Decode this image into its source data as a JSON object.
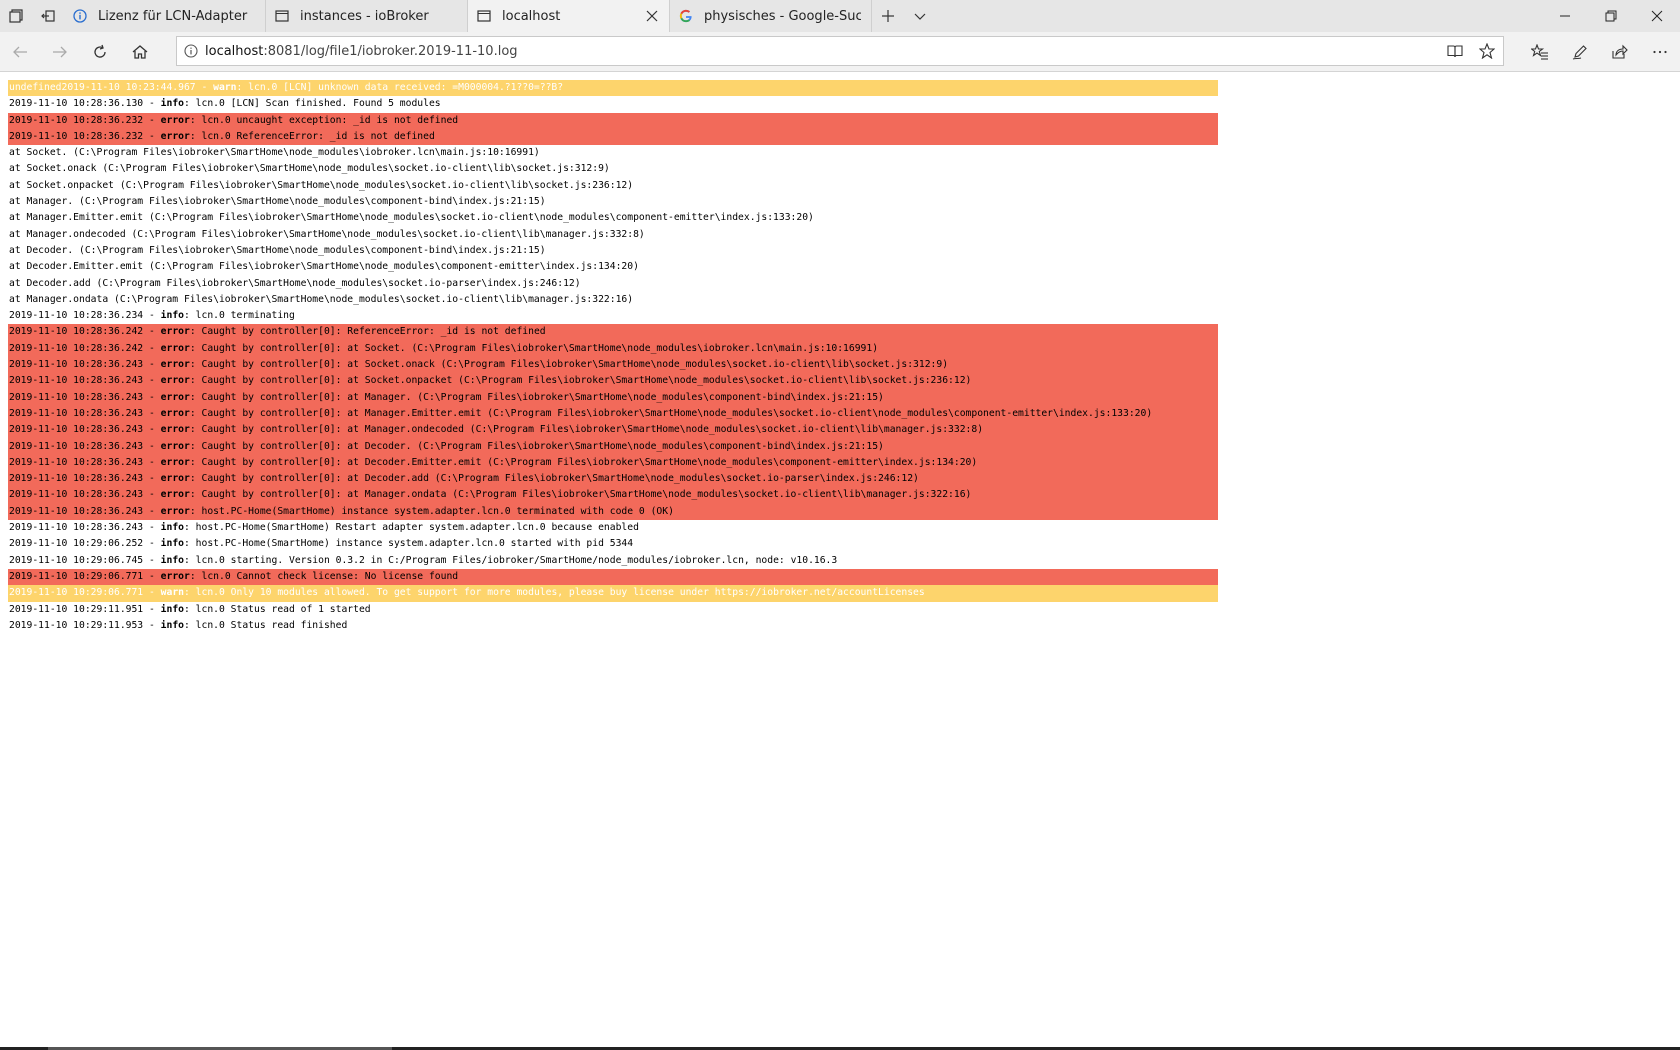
{
  "tabs": [
    {
      "title": "Lizenz für LCN-Adapter",
      "icon": "info-circle-icon",
      "active": false
    },
    {
      "title": "instances - ioBroker",
      "icon": "page-icon",
      "active": false
    },
    {
      "title": "localhost",
      "icon": "page-icon",
      "active": true
    },
    {
      "title": "physisches - Google-Suche",
      "icon": "google-icon",
      "active": false
    }
  ],
  "address": {
    "host": "localhost",
    "path": ":8081/log/file1/iobroker.2019-11-10.log"
  },
  "colors": {
    "error_bg": "#f26a5a",
    "warn_bg": "#fdd46c"
  },
  "log_lines": [
    {
      "type": "warn",
      "prefix": "undefined2019-11-10 10:23:44.967 - ",
      "level": "warn",
      "message": ": lcn.0 [LCN] unknown data received: =M000004.?1??0=??B?"
    },
    {
      "type": "info",
      "prefix": "2019-11-10 10:28:36.130 - ",
      "level": "info",
      "message": ": lcn.0 [LCN] Scan finished. Found 5 modules"
    },
    {
      "type": "error",
      "prefix": "2019-11-10 10:28:36.232 - ",
      "level": "error",
      "message": ": lcn.0 uncaught exception: _id is not defined"
    },
    {
      "type": "error",
      "prefix": "2019-11-10 10:28:36.232 - ",
      "level": "error",
      "message": ": lcn.0 ReferenceError: _id is not defined"
    },
    {
      "type": "plain",
      "prefix": "",
      "level": "",
      "message": "at Socket. (C:\\Program Files\\iobroker\\SmartHome\\node_modules\\iobroker.lcn\\main.js:10:16991)"
    },
    {
      "type": "plain",
      "prefix": "",
      "level": "",
      "message": "at Socket.onack (C:\\Program Files\\iobroker\\SmartHome\\node_modules\\socket.io-client\\lib\\socket.js:312:9)"
    },
    {
      "type": "plain",
      "prefix": "",
      "level": "",
      "message": "at Socket.onpacket (C:\\Program Files\\iobroker\\SmartHome\\node_modules\\socket.io-client\\lib\\socket.js:236:12)"
    },
    {
      "type": "plain",
      "prefix": "",
      "level": "",
      "message": "at Manager. (C:\\Program Files\\iobroker\\SmartHome\\node_modules\\component-bind\\index.js:21:15)"
    },
    {
      "type": "plain",
      "prefix": "",
      "level": "",
      "message": "at Manager.Emitter.emit (C:\\Program Files\\iobroker\\SmartHome\\node_modules\\socket.io-client\\node_modules\\component-emitter\\index.js:133:20)"
    },
    {
      "type": "plain",
      "prefix": "",
      "level": "",
      "message": "at Manager.ondecoded (C:\\Program Files\\iobroker\\SmartHome\\node_modules\\socket.io-client\\lib\\manager.js:332:8)"
    },
    {
      "type": "plain",
      "prefix": "",
      "level": "",
      "message": "at Decoder. (C:\\Program Files\\iobroker\\SmartHome\\node_modules\\component-bind\\index.js:21:15)"
    },
    {
      "type": "plain",
      "prefix": "",
      "level": "",
      "message": "at Decoder.Emitter.emit (C:\\Program Files\\iobroker\\SmartHome\\node_modules\\component-emitter\\index.js:134:20)"
    },
    {
      "type": "plain",
      "prefix": "",
      "level": "",
      "message": "at Decoder.add (C:\\Program Files\\iobroker\\SmartHome\\node_modules\\socket.io-parser\\index.js:246:12)"
    },
    {
      "type": "plain",
      "prefix": "",
      "level": "",
      "message": "at Manager.ondata (C:\\Program Files\\iobroker\\SmartHome\\node_modules\\socket.io-client\\lib\\manager.js:322:16)"
    },
    {
      "type": "info",
      "prefix": "2019-11-10 10:28:36.234 - ",
      "level": "info",
      "message": ": lcn.0 terminating"
    },
    {
      "type": "error",
      "prefix": "2019-11-10 10:28:36.242 - ",
      "level": "error",
      "message": ": Caught by controller[0]: ReferenceError: _id is not defined"
    },
    {
      "type": "error",
      "prefix": "2019-11-10 10:28:36.242 - ",
      "level": "error",
      "message": ": Caught by controller[0]: at Socket. (C:\\Program Files\\iobroker\\SmartHome\\node_modules\\iobroker.lcn\\main.js:10:16991)"
    },
    {
      "type": "error",
      "prefix": "2019-11-10 10:28:36.243 - ",
      "level": "error",
      "message": ": Caught by controller[0]: at Socket.onack (C:\\Program Files\\iobroker\\SmartHome\\node_modules\\socket.io-client\\lib\\socket.js:312:9)"
    },
    {
      "type": "error",
      "prefix": "2019-11-10 10:28:36.243 - ",
      "level": "error",
      "message": ": Caught by controller[0]: at Socket.onpacket (C:\\Program Files\\iobroker\\SmartHome\\node_modules\\socket.io-client\\lib\\socket.js:236:12)"
    },
    {
      "type": "error",
      "prefix": "2019-11-10 10:28:36.243 - ",
      "level": "error",
      "message": ": Caught by controller[0]: at Manager. (C:\\Program Files\\iobroker\\SmartHome\\node_modules\\component-bind\\index.js:21:15)"
    },
    {
      "type": "error",
      "prefix": "2019-11-10 10:28:36.243 - ",
      "level": "error",
      "message": ": Caught by controller[0]: at Manager.Emitter.emit (C:\\Program Files\\iobroker\\SmartHome\\node_modules\\socket.io-client\\node_modules\\component-emitter\\index.js:133:20)"
    },
    {
      "type": "error",
      "prefix": "2019-11-10 10:28:36.243 - ",
      "level": "error",
      "message": ": Caught by controller[0]: at Manager.ondecoded (C:\\Program Files\\iobroker\\SmartHome\\node_modules\\socket.io-client\\lib\\manager.js:332:8)"
    },
    {
      "type": "error",
      "prefix": "2019-11-10 10:28:36.243 - ",
      "level": "error",
      "message": ": Caught by controller[0]: at Decoder. (C:\\Program Files\\iobroker\\SmartHome\\node_modules\\component-bind\\index.js:21:15)"
    },
    {
      "type": "error",
      "prefix": "2019-11-10 10:28:36.243 - ",
      "level": "error",
      "message": ": Caught by controller[0]: at Decoder.Emitter.emit (C:\\Program Files\\iobroker\\SmartHome\\node_modules\\component-emitter\\index.js:134:20)"
    },
    {
      "type": "error",
      "prefix": "2019-11-10 10:28:36.243 - ",
      "level": "error",
      "message": ": Caught by controller[0]: at Decoder.add (C:\\Program Files\\iobroker\\SmartHome\\node_modules\\socket.io-parser\\index.js:246:12)"
    },
    {
      "type": "error",
      "prefix": "2019-11-10 10:28:36.243 - ",
      "level": "error",
      "message": ": Caught by controller[0]: at Manager.ondata (C:\\Program Files\\iobroker\\SmartHome\\node_modules\\socket.io-client\\lib\\manager.js:322:16)"
    },
    {
      "type": "error",
      "prefix": "2019-11-10 10:28:36.243 - ",
      "level": "error",
      "message": ": host.PC-Home(SmartHome) instance system.adapter.lcn.0 terminated with code 0 (OK)"
    },
    {
      "type": "info",
      "prefix": "2019-11-10 10:28:36.243 - ",
      "level": "info",
      "message": ": host.PC-Home(SmartHome) Restart adapter system.adapter.lcn.0 because enabled"
    },
    {
      "type": "info",
      "prefix": "2019-11-10 10:29:06.252 - ",
      "level": "info",
      "message": ": host.PC-Home(SmartHome) instance system.adapter.lcn.0 started with pid 5344"
    },
    {
      "type": "info",
      "prefix": "2019-11-10 10:29:06.745 - ",
      "level": "info",
      "message": ": lcn.0 starting. Version 0.3.2 in C:/Program Files/iobroker/SmartHome/node_modules/iobroker.lcn, node: v10.16.3"
    },
    {
      "type": "error",
      "prefix": "2019-11-10 10:29:06.771 - ",
      "level": "error",
      "message": ": lcn.0 Cannot check license: No license found"
    },
    {
      "type": "warn",
      "prefix": "2019-11-10 10:29:06.771 - ",
      "level": "warn",
      "message": ": lcn.0 Only 10 modules allowed. To get support for more modules, please buy license under https://iobroker.net/accountLicenses"
    },
    {
      "type": "info",
      "prefix": "2019-11-10 10:29:11.951 - ",
      "level": "info",
      "message": ": lcn.0 Status read of 1 started"
    },
    {
      "type": "info",
      "prefix": "2019-11-10 10:29:11.953 - ",
      "level": "info",
      "message": ": lcn.0 Status read finished"
    }
  ]
}
